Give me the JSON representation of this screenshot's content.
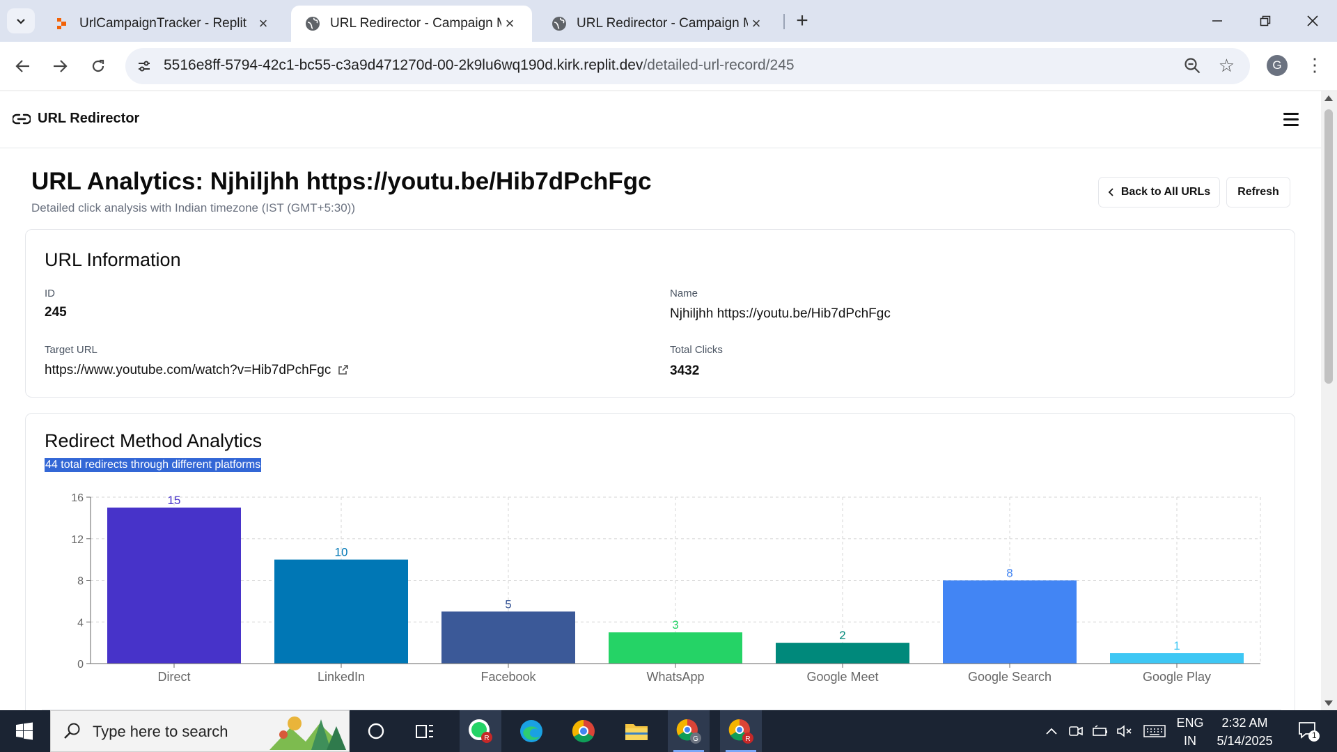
{
  "browser": {
    "tabs": [
      {
        "title": "UrlCampaignTracker - Replit",
        "favicon": "replit-icon",
        "active": false
      },
      {
        "title": "URL Redirector - Campaign Mar",
        "favicon": "globe-icon",
        "active": true
      },
      {
        "title": "URL Redirector - Campaign Mar",
        "favicon": "globe-icon",
        "active": false
      }
    ],
    "url_host": "5516e8ff-5794-42c1-bc55-c3a9d471270d-00-2k9lu6wq190d.kirk.replit.dev",
    "url_path": "/detailed-url-record/245",
    "profile_initial": "G"
  },
  "app": {
    "brand": "URL Redirector",
    "page_title": "URL Analytics: Njhiljhh https://youtu.be/Hib7dPchFgc",
    "page_subtitle": "Detailed click analysis with Indian timezone (IST (GMT+5:30))",
    "back_button": "Back to All URLs",
    "refresh_button": "Refresh"
  },
  "url_info": {
    "heading": "URL Information",
    "id_label": "ID",
    "id_value": "245",
    "name_label": "Name",
    "name_value": "Njhiljhh https://youtu.be/Hib7dPchFgc",
    "target_label": "Target URL",
    "target_value": "https://www.youtube.com/watch?v=Hib7dPchFgc",
    "clicks_label": "Total Clicks",
    "clicks_value": "3432"
  },
  "chart_section": {
    "heading": "Redirect Method Analytics",
    "subtitle": "44 total redirects through different platforms"
  },
  "chart_data": {
    "type": "bar",
    "categories": [
      "Direct",
      "LinkedIn",
      "Facebook",
      "WhatsApp",
      "Google Meet",
      "Google Search",
      "Google Play"
    ],
    "values": [
      15,
      10,
      5,
      3,
      2,
      8,
      1
    ],
    "colors": [
      "#4733c9",
      "#0077b5",
      "#3b5998",
      "#25d366",
      "#00897b",
      "#4285f4",
      "#3ec7f4"
    ],
    "ylim": [
      0,
      16
    ],
    "yticks": [
      0,
      4,
      8,
      12,
      16
    ],
    "grid": true,
    "data_labels": true
  },
  "taskbar": {
    "search_placeholder": "Type here to search",
    "lang_top": "ENG",
    "lang_bottom": "IN",
    "time": "2:32 AM",
    "date": "5/14/2025",
    "notification_count": "1"
  }
}
